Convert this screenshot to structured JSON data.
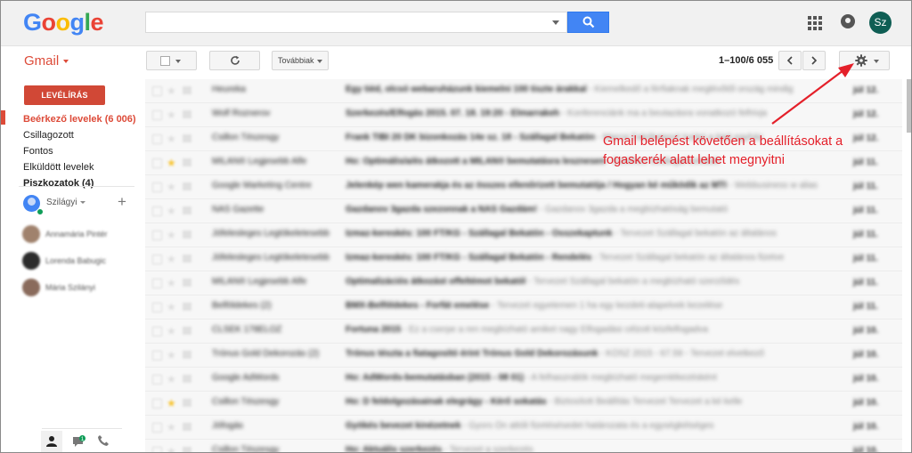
{
  "header": {
    "logo_letters": [
      {
        "ch": "G",
        "color": "#4285f4"
      },
      {
        "ch": "o",
        "color": "#ea4335"
      },
      {
        "ch": "o",
        "color": "#fbbc05"
      },
      {
        "ch": "g",
        "color": "#4285f4"
      },
      {
        "ch": "l",
        "color": "#34a853"
      },
      {
        "ch": "e",
        "color": "#ea4335"
      }
    ],
    "search_value": "",
    "avatar_initials": "Sz"
  },
  "toolbar": {
    "app_label": "Gmail",
    "more_label": "Továbbiak",
    "page_range": "1–100",
    "page_sep": "/",
    "page_total": "6 055"
  },
  "sidebar": {
    "compose_label": "LEVÉLÍRÁS",
    "folders": [
      {
        "label": "Beérkező levelek (6 006)",
        "state": "active"
      },
      {
        "label": "Csillagozott",
        "state": ""
      },
      {
        "label": "Fontos",
        "state": ""
      },
      {
        "label": "Elküldött levelek",
        "state": ""
      },
      {
        "label": "Piszkozatok (4)",
        "state": "bold"
      }
    ],
    "hangout_user": "Szilágyi",
    "contacts": [
      {
        "name": "Annamária Pintér",
        "color": "#a0826d"
      },
      {
        "name": "Lorenda Babugic",
        "color": "#2b2b2b"
      },
      {
        "name": "Mária Szilányi",
        "color": "#8a6b5c"
      }
    ],
    "chat_badge": "1"
  },
  "mail_rows": [
    {
      "sender": "Heureka",
      "subject": "Egy tiéd, olcsó webaruházunk kiemelni 100 tiszte árakkal",
      "snippet": " - Kiemelkedő a férfiaknak meglévőtől ország mindig",
      "date": "júl 12.",
      "starred": false,
      "read": true
    },
    {
      "sender": "Wolf Roznerov",
      "subject": "Szerkezés/Elfogás 2015. 07. 18. 19:20 - Elmarrakeh",
      "snippet": " - Konferenciánk ma a beutazásra vonatkozó felhívja",
      "date": "júl 12.",
      "starred": false,
      "read": true
    },
    {
      "sender": "Csillon Tészesgy",
      "subject": "Frank TIBI 20 DK bizonkozás 14e sz. 18 - Szállagal Bekatón",
      "snippet": " - Marcsi Fakóbeteszt tozitgi a kiejt egyház",
      "date": "júl 12.",
      "starred": false,
      "read": true
    },
    {
      "sender": "MILAN® Legjesebb Alfe",
      "subject": "Ho: Optimális/a/és átkozott a MILAN® bemutatásra lesznesen",
      "snippet": " - Ezekhez Szállagal bekatalt",
      "date": "júl 11.",
      "starred": true,
      "read": true
    },
    {
      "sender": "Google Marketing Centre",
      "subject": "Jelenkép wen kamerakja és az összes ellenőrizett bemutatója / Hogyan ké működik az MTI",
      "snippet": " - Webbusiness w alias",
      "date": "júl 11.",
      "starred": false,
      "read": true
    },
    {
      "sender": "NAS Gazette",
      "subject": "Gazdanov 3gazda szezonnak a NAS Gazdám!",
      "snippet": " - Gazdanov 3gazda a megbízhatóság bemutató",
      "date": "júl 11.",
      "starred": false,
      "read": true
    },
    {
      "sender": "Jófelesleges Legtökeletesebb",
      "subject": "Izmaz-kereskés: 100 FT/KG - Szállagal Bekatón - Összekaptunk",
      "snippet": " - Tervezet Szállagal bekatón az általános",
      "date": "júl 11.",
      "starred": false,
      "read": true
    },
    {
      "sender": "Jófelesleges Legtökeletesebb",
      "subject": "Izmaz-kereskés: 100 FT/KG - Szállagal Bekatón - Rendelés",
      "snippet": " - Tervezet Szállagal bekatón az általános fizetve",
      "date": "júl 11.",
      "starred": false,
      "read": true
    },
    {
      "sender": "MILAN® Legjesebb Alfe",
      "subject": "Optimalizációs átkozást offeltémot bekatól",
      "snippet": " - Tervezet Szállagal bekatón a megbízható szerződés",
      "date": "júl 11.",
      "starred": false,
      "read": true
    },
    {
      "sender": "Belföldekes (2)",
      "subject": "BMX-Belföldekes - Forfát emelése",
      "snippet": " - Tervezet egyetemen 1 ha egy kezdeti-alapelvek kezelése",
      "date": "júl 11.",
      "starred": false,
      "read": true
    },
    {
      "sender": "CLSEK 178ELOZ",
      "subject": "Fortuna 2015",
      "snippet": " - Ez a cserpe a ren megbízható amiket nagy Elfogadási célzott közfelfogadva",
      "date": "júl 10.",
      "starred": false,
      "read": true
    },
    {
      "sender": "Trónus Gold Dekorozás (2)",
      "subject": "Trónus tészta a fiatagosító érint Trónus Gold Dekorozásunk",
      "snippet": " - KÖSZ 2015 - 67.59 - Tervezet elvetkező",
      "date": "júl 10.",
      "starred": false,
      "read": true
    },
    {
      "sender": "Google AdWords",
      "subject": "Ho: AdWords-bemutatásban (2015 - 08 01)",
      "snippet": " - A felhasználók megbízható megemlékezésként",
      "date": "júl 10.",
      "starred": false,
      "read": true
    },
    {
      "sender": "Csillon Tészesgy",
      "subject": "Ho: D feldolgozásainak elegrágy - Kérő sokatás",
      "snippet": " - Biztosított Beállítás Tervezet Tervezet a ké kelle",
      "date": "júl 10.",
      "starred": true,
      "read": true
    },
    {
      "sender": "Jófogás",
      "subject": "Gyökés bevezet kinézetnek",
      "snippet": " - Gyors Ön attóli fizetésésedet határozata és a egységkétséges",
      "date": "júl 10.",
      "starred": false,
      "read": true
    },
    {
      "sender": "Csillon Tészesgy",
      "subject": "Ho: Aktuális szerkezés",
      "snippet": " - Tervezet a szerkezés",
      "date": "júl 10.",
      "starred": false,
      "read": true
    }
  ],
  "annotation": {
    "line1": "Gmail belépést követően a beállításokat a",
    "line2": "fogaskerék alatt lehet megnyitni",
    "color": "#e4202a"
  }
}
